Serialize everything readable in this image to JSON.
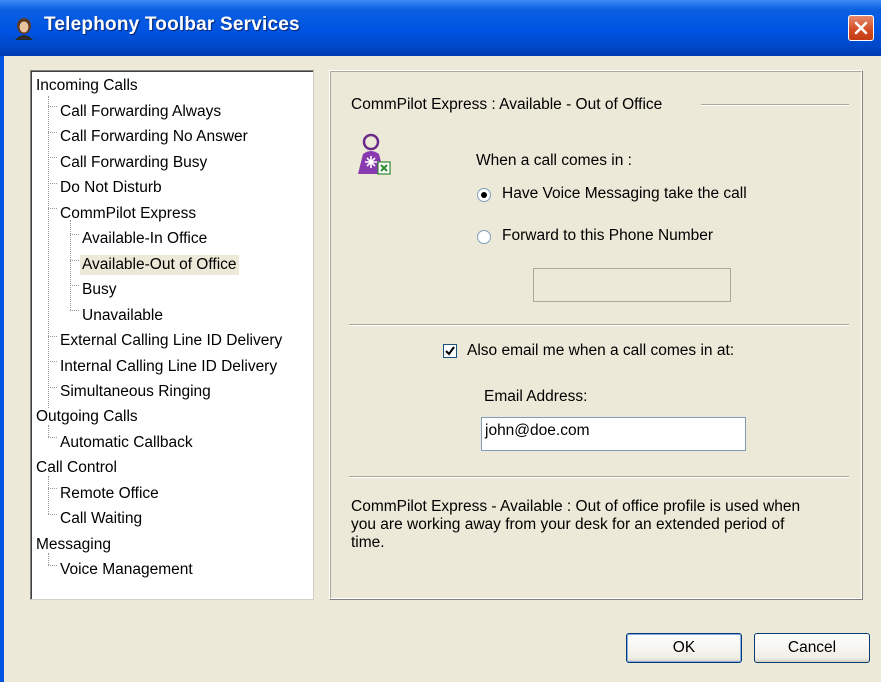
{
  "window": {
    "title": "Telephony Toolbar Services"
  },
  "tree": {
    "items": [
      "Incoming Calls",
      "Call Forwarding Always",
      "Call Forwarding No Answer",
      "Call Forwarding Busy",
      "Do Not Disturb",
      "CommPilot Express",
      "Available-In Office",
      "Available-Out of Office",
      "Busy",
      "Unavailable",
      "External Calling Line ID Delivery",
      "Internal Calling Line ID Delivery",
      "Simultaneous Ringing",
      "Outgoing Calls",
      "Automatic Callback",
      "Call Control",
      "Remote Office",
      "Call Waiting",
      "Messaging",
      "Voice Management"
    ],
    "selected": "Available-Out of Office"
  },
  "panel": {
    "group_title": "CommPilot Express : Available  - Out of Office",
    "when_call_label": "When a call comes in :",
    "radio_voice_label": "Have Voice Messaging take the call",
    "radio_forward_label": "Forward to this Phone Number",
    "forward_number_value": "",
    "email_checkbox_label": "Also email me when a call comes in at:",
    "email_address_label": "Email Address:",
    "email_value": "john@doe.com",
    "description": [
      "CommPilot Express - Available : Out of office profile is used when",
      "you are working away from your desk for an extended period of",
      "time."
    ]
  },
  "buttons": {
    "ok": "OK",
    "cancel": "Cancel"
  },
  "colors": {
    "titlebar": "#0054e3",
    "dialog_bg": "#ece9d8",
    "close": "#d24b21"
  },
  "icons": {
    "app": "user-avatar-icon",
    "close": "close-icon",
    "profile": "commpilot-user-icon"
  }
}
